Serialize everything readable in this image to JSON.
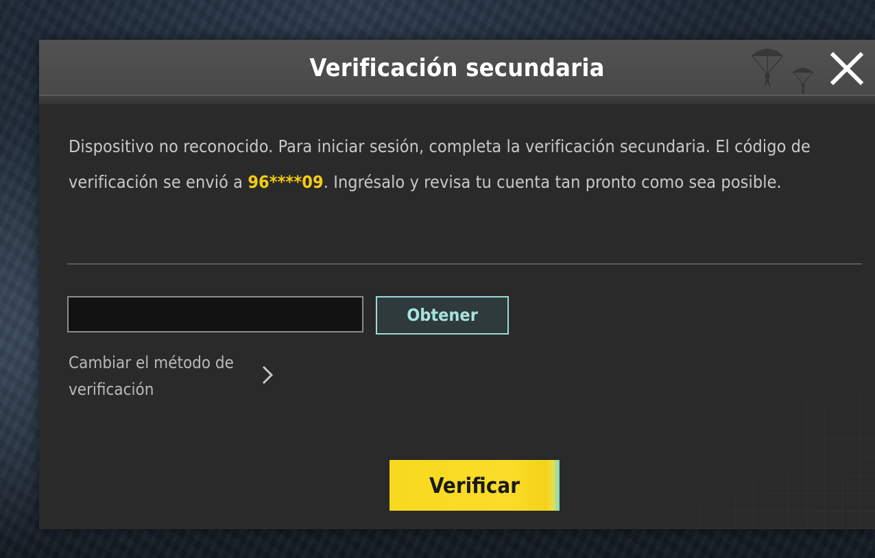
{
  "dialog": {
    "title": "Verificación secundaria",
    "close_icon": "close-icon"
  },
  "message": {
    "before": "Dispositivo no reconocido. Para iniciar sesión, completa la verificación secundaria. El código de verificación se envió a ",
    "phone": "96****09",
    "after": ". Ingrésalo y revisa tu cuenta tan pronto como sea posible."
  },
  "form": {
    "code_value": "",
    "code_placeholder": "",
    "get_code_label": "Obtener",
    "change_method_label": "Cambiar el método de verificación",
    "change_method_icon": "chevron-right-icon",
    "verify_label": "Verificar"
  },
  "colors": {
    "accent_yellow": "#f8d91e",
    "highlight_text": "#f5cc12",
    "secondary_button_border": "#9fdcd8",
    "dialog_background": "#2a2a2a",
    "header_background": "#4d4d4d"
  }
}
